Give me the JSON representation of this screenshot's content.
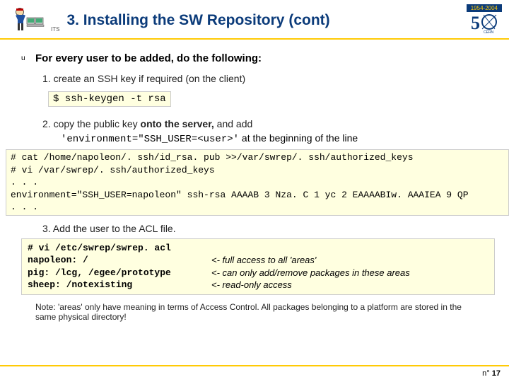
{
  "header": {
    "its": "ITS",
    "title": "3. Installing the SW Repository (cont)",
    "badge_years": "1954-2004",
    "badge_num": "5"
  },
  "top_line": "For every user to be added, do the following:",
  "step1": {
    "text": "1. create an SSH key if required (on the client)",
    "code": "$ ssh-keygen -t rsa"
  },
  "step2": {
    "line_a": "2. copy the public key ",
    "line_a_bold": "onto the server,",
    "line_a_rest": " and add",
    "sub_code": "'environment=\"SSH_USER=<user>'",
    "sub_rest": " at the beginning of the line",
    "code": "# cat /home/napoleon/. ssh/id_rsa. pub >>/var/swrep/. ssh/authorized_keys\n# vi /var/swrep/. ssh/authorized_keys\n. . .\nenvironment=\"SSH_USER=napoleon\" ssh-rsa AAAAB 3 Nza. C 1 yc 2 EAAAABIw. AAAIEA 9 QP\n. . ."
  },
  "step3": {
    "text": "3. Add the user to the ACL file.",
    "acl_cmd": "# vi /etc/swrep/swrep. acl",
    "rows": [
      {
        "l": "napoleon: /",
        "r": "<- full access to all 'areas'"
      },
      {
        "l": "pig: /lcg, /egee/prototype",
        "r": "<- can only add/remove packages in these areas"
      },
      {
        "l": "sheep: /notexisting",
        "r": "<- read-only access"
      }
    ]
  },
  "note": "Note: 'areas' only have meaning in terms of Access Control. All packages belonging to a platform are stored in the same physical directory!",
  "footer": {
    "page_prefix": "n°",
    "page_num": "17"
  }
}
